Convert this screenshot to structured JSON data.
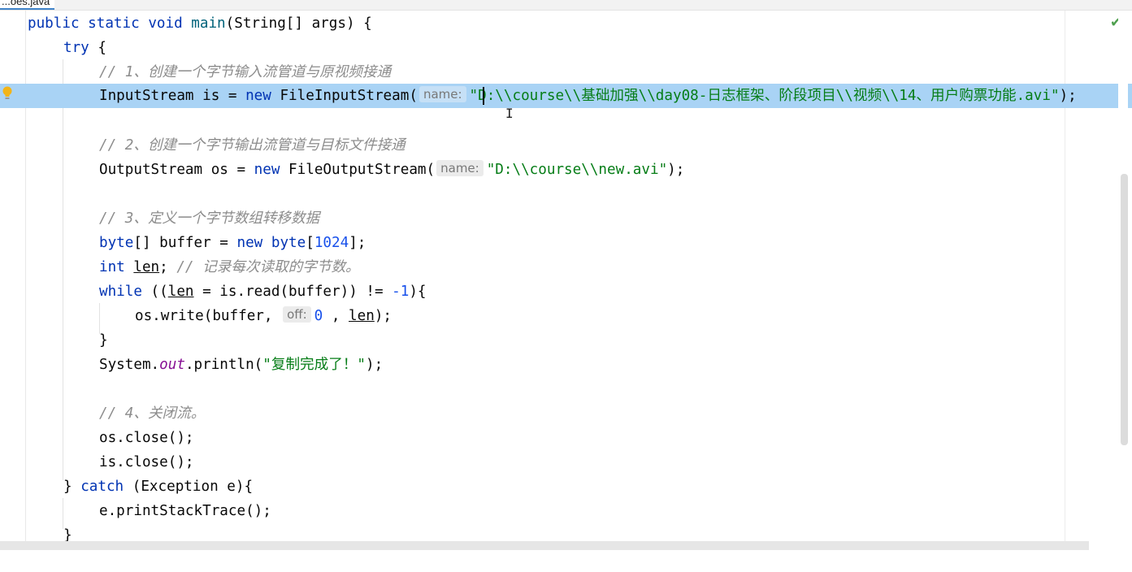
{
  "tab": {
    "file_name": "...oes.java"
  },
  "status": {
    "inspection_icon": "checkmark-icon"
  },
  "hints": {
    "name": "name:",
    "off": "off:"
  },
  "code": {
    "l1": {
      "public": "public",
      "static": "static",
      "void": "void",
      "main": "main",
      "rest": "(String[] args) {"
    },
    "l2": {
      "try": "try",
      "rest": " {"
    },
    "l3": {
      "comment": "// 1、创建一个字节输入流管道与原视频接通"
    },
    "l4": {
      "pre": "InputStream is = ",
      "new": "new",
      "post": " FileInputStream(",
      "str": "\"D:\\\\course\\\\基础加强\\\\day08-日志框架、阶段项目\\\\视频\\\\14、用户购票功能.avi\"",
      "end": ");"
    },
    "l6": {
      "comment": "// 2、创建一个字节输出流管道与目标文件接通"
    },
    "l7": {
      "pre": "OutputStream os = ",
      "new": "new",
      "post": " FileOutputStream(",
      "str": "\"D:\\\\course\\\\new.avi\"",
      "end": ");"
    },
    "l9": {
      "comment": "// 3、定义一个字节数组转移数据"
    },
    "l10": {
      "byte1": "byte",
      "mid": "[] buffer = ",
      "new": "new",
      "byte2": "byte",
      "open": "[",
      "num": "1024",
      "close": "];"
    },
    "l11": {
      "int": "int",
      "len": "len",
      "semi": "; ",
      "comment": "// 记录每次读取的字节数。"
    },
    "l12": {
      "while": "while",
      "a": " ((",
      "len": "len",
      "b": " = is.read(buffer)) != ",
      "num": "-1",
      "c": "){"
    },
    "l13": {
      "a": "os.write(buffer, ",
      "num": "0",
      "b": " , ",
      "len": "len",
      "c": ");"
    },
    "l14": {
      "brace": "}"
    },
    "l15": {
      "a": "System.",
      "out": "out",
      "b": ".println(",
      "str": "\"复制完成了！\"",
      "c": ");"
    },
    "l17": {
      "comment": "// 4、关闭流。"
    },
    "l18": {
      "text": "os.close();"
    },
    "l19": {
      "text": "is.close();"
    },
    "l20": {
      "a": "} ",
      "catch": "catch",
      "b": " (Exception e){"
    },
    "l21": {
      "text": "e.printStackTrace();"
    },
    "l22": {
      "brace": "}"
    }
  }
}
